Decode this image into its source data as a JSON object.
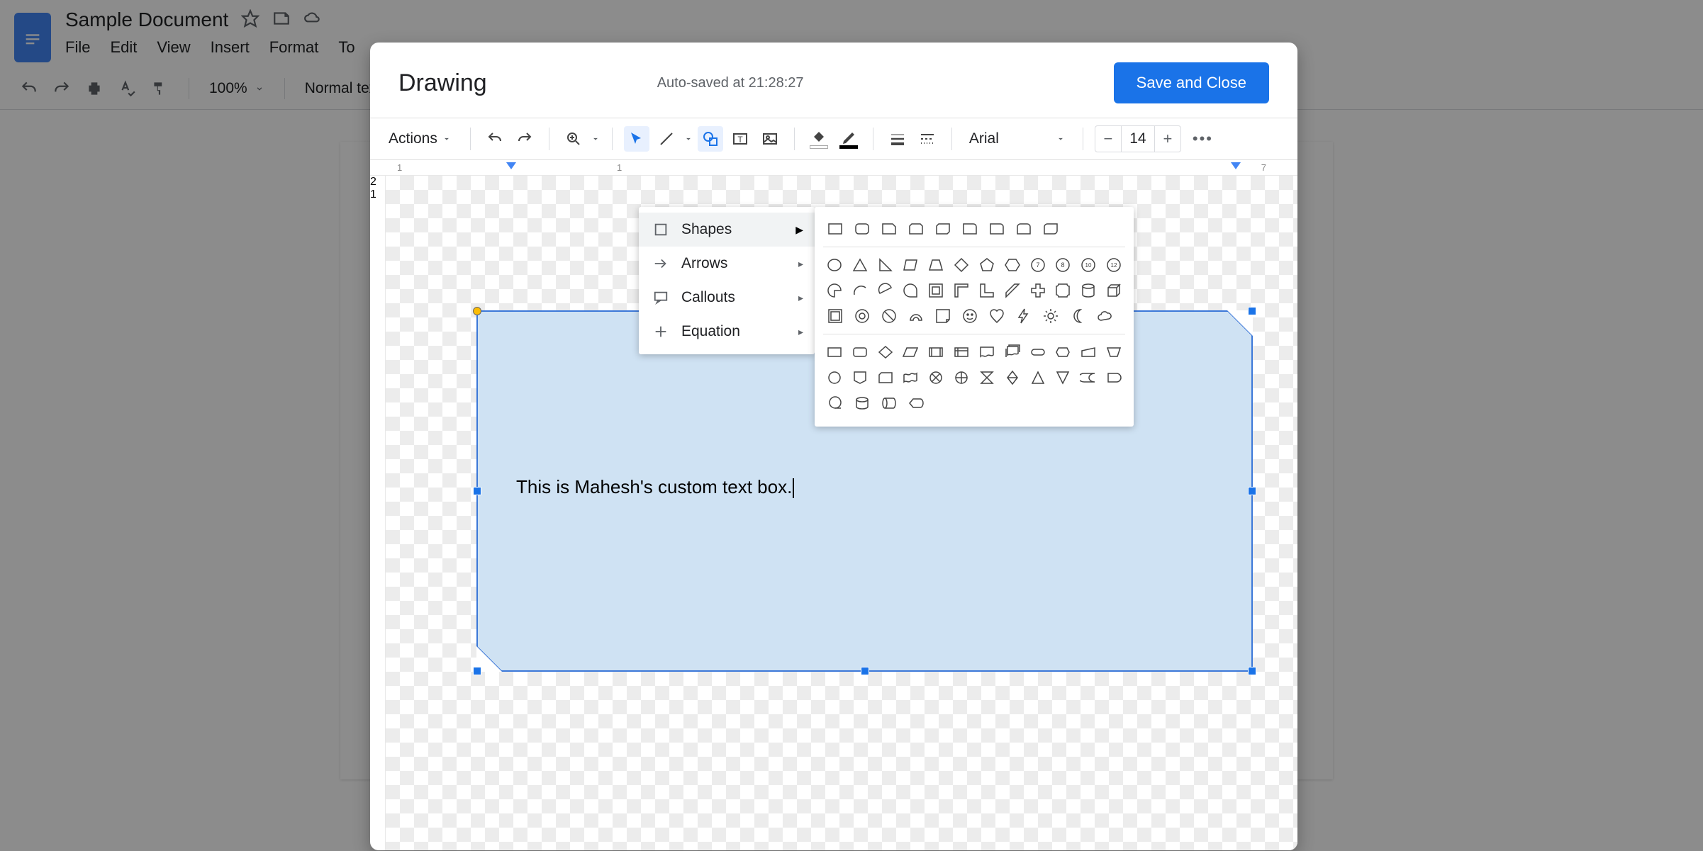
{
  "docs": {
    "title": "Sample Document",
    "menus": [
      "File",
      "Edit",
      "View",
      "Insert",
      "Format",
      "To"
    ],
    "zoom": "100%",
    "style": "Normal text"
  },
  "dialog": {
    "title": "Drawing",
    "status": "Auto-saved at 21:28:27",
    "save_label": "Save and Close",
    "actions_label": "Actions",
    "font": "Arial",
    "font_size": "14",
    "ruler_h": [
      "1",
      "1",
      "7"
    ],
    "ruler_v": [
      "2",
      "1"
    ],
    "shape_text": "This is Mahesh's custom text box.",
    "shape_menu": [
      {
        "label": "Shapes",
        "icon": "rect"
      },
      {
        "label": "Arrows",
        "icon": "arrow"
      },
      {
        "label": "Callouts",
        "icon": "callout"
      },
      {
        "label": "Equation",
        "icon": "plus"
      }
    ]
  }
}
